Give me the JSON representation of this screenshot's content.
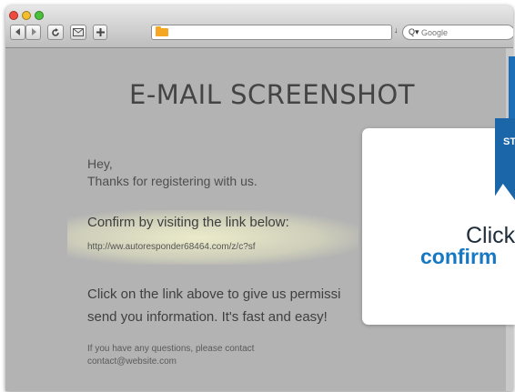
{
  "browser": {
    "back_glyph": "◀",
    "forward_glyph": "▶",
    "reload_glyph": "c",
    "add_glyph": "+",
    "search_placeholder": "Google",
    "address_value": ""
  },
  "page": {
    "title": "E-MAIL SCREENSHOT",
    "greeting": "Hey,",
    "thanks": "Thanks for registering with us.",
    "confirm_line": "Confirm by visiting the link below:",
    "confirm_link": "http://ww.autoresponder68464.com/z/c?sf",
    "body_line1": "Click on the link above to give us permissi",
    "body_line2": "send you information. It's fast and easy!",
    "contact_line1": "If you have any questions, please contact",
    "contact_line2": "contact@website.com"
  },
  "overlay": {
    "ribbon_text": "ST",
    "title": "Click",
    "subtitle": "confirm"
  },
  "colors": {
    "accent_blue": "#1c6fb6",
    "link_blue": "#1678c2"
  }
}
